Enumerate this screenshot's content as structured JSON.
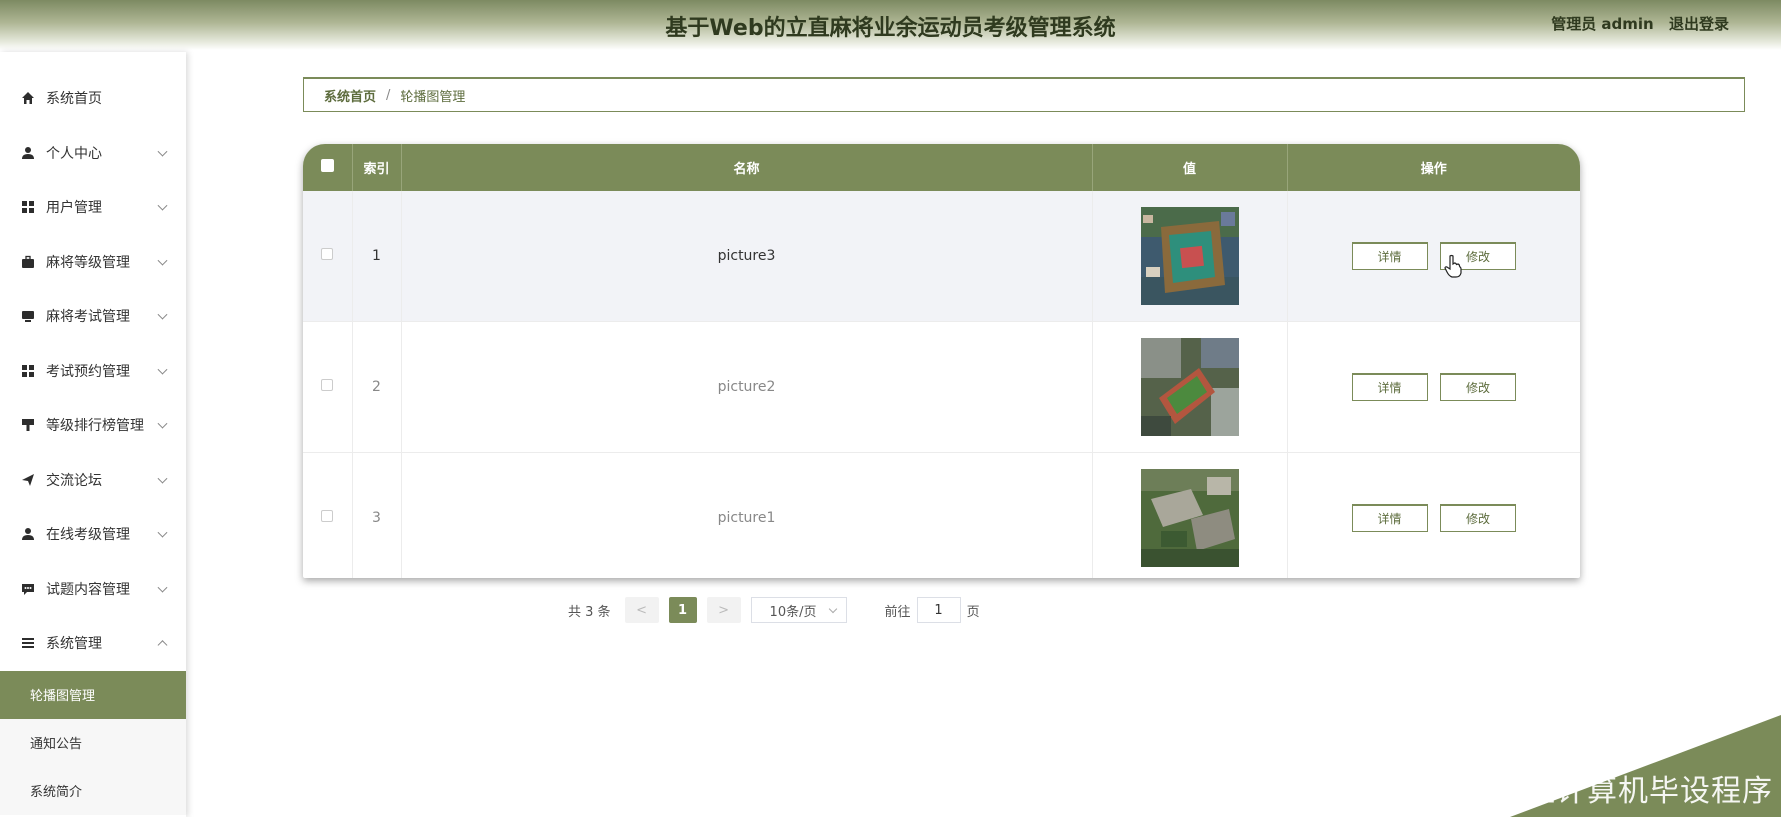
{
  "header": {
    "title": "基于Web的立直麻将业余运动员考级管理系统",
    "user_label": "管理员 admin",
    "logout_label": "退出登录"
  },
  "sidebar": {
    "items": [
      {
        "label": "系统首页",
        "icon": "home-icon",
        "expandable": false
      },
      {
        "label": "个人中心",
        "icon": "user-icon",
        "expandable": true
      },
      {
        "label": "用户管理",
        "icon": "grid-icon",
        "expandable": true
      },
      {
        "label": "麻将等级管理",
        "icon": "briefcase-icon",
        "expandable": true
      },
      {
        "label": "麻将考试管理",
        "icon": "monitor-icon",
        "expandable": true
      },
      {
        "label": "考试预约管理",
        "icon": "grid-icon",
        "expandable": true
      },
      {
        "label": "等级排行榜管理",
        "icon": "brush-icon",
        "expandable": true
      },
      {
        "label": "交流论坛",
        "icon": "send-icon",
        "expandable": true
      },
      {
        "label": "在线考级管理",
        "icon": "user-icon",
        "expandable": true
      },
      {
        "label": "试题内容管理",
        "icon": "chat-icon",
        "expandable": true
      },
      {
        "label": "系统管理",
        "icon": "list-icon",
        "expandable": true,
        "expanded": true
      }
    ],
    "sub_items": [
      {
        "label": "轮播图管理",
        "active": true
      },
      {
        "label": "通知公告",
        "active": false
      },
      {
        "label": "系统简介",
        "active": false
      }
    ]
  },
  "breadcrumb": {
    "home": "系统首页",
    "separator": "/",
    "current": "轮播图管理"
  },
  "table": {
    "columns": [
      "索引",
      "名称",
      "值",
      "操作"
    ],
    "rows": [
      {
        "index": "1",
        "name": "picture3",
        "image": "aerial-campus-stadium-blue"
      },
      {
        "index": "2",
        "name": "picture2",
        "image": "aerial-track-field"
      },
      {
        "index": "3",
        "name": "picture1",
        "image": "aerial-campus-buildings"
      }
    ],
    "detail_label": "详情",
    "edit_label": "修改"
  },
  "pagination": {
    "total_text": "共 3 条",
    "prev": "<",
    "next": ">",
    "current_page": "1",
    "page_size": "10条/页",
    "goto_prefix": "前往",
    "goto_value": "1",
    "goto_suffix": "页"
  },
  "watermark": "CSDN @学姐计算机毕设程序",
  "colors": {
    "accent": "#7b8b59",
    "header_text": "#2f3a1f"
  }
}
